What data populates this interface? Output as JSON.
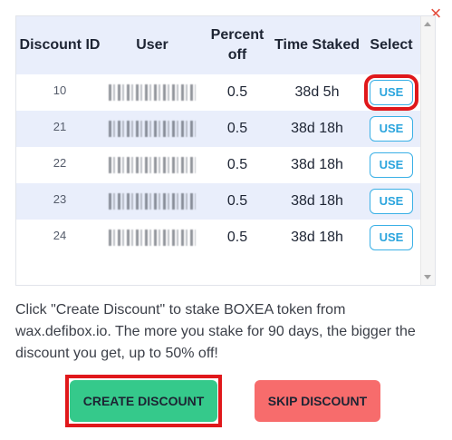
{
  "close_label": "×",
  "table": {
    "headers": [
      "Discount ID",
      "User",
      "Percent off",
      "Time Staked",
      "Select"
    ],
    "rows": [
      {
        "id": "10",
        "percent": "0.5",
        "time": "38d 5h",
        "select": "USE"
      },
      {
        "id": "21",
        "percent": "0.5",
        "time": "38d 18h",
        "select": "USE"
      },
      {
        "id": "22",
        "percent": "0.5",
        "time": "38d 18h",
        "select": "USE"
      },
      {
        "id": "23",
        "percent": "0.5",
        "time": "38d 18h",
        "select": "USE"
      },
      {
        "id": "24",
        "percent": "0.5",
        "time": "38d 18h",
        "select": "USE"
      }
    ]
  },
  "info_text": "Click \"Create Discount\" to stake BOXEA token from wax.defibox.io. The more you stake for 90 days, the bigger the discount you get, up to 50% off!",
  "buttons": {
    "create": "CREATE DISCOUNT",
    "skip": "SKIP DISCOUNT"
  },
  "colors": {
    "accent_blue": "#3ab0e6",
    "highlight_red": "#e0181b",
    "create_green": "#35c98b",
    "skip_red": "#f76c6c",
    "close_red": "#e44c3c"
  }
}
